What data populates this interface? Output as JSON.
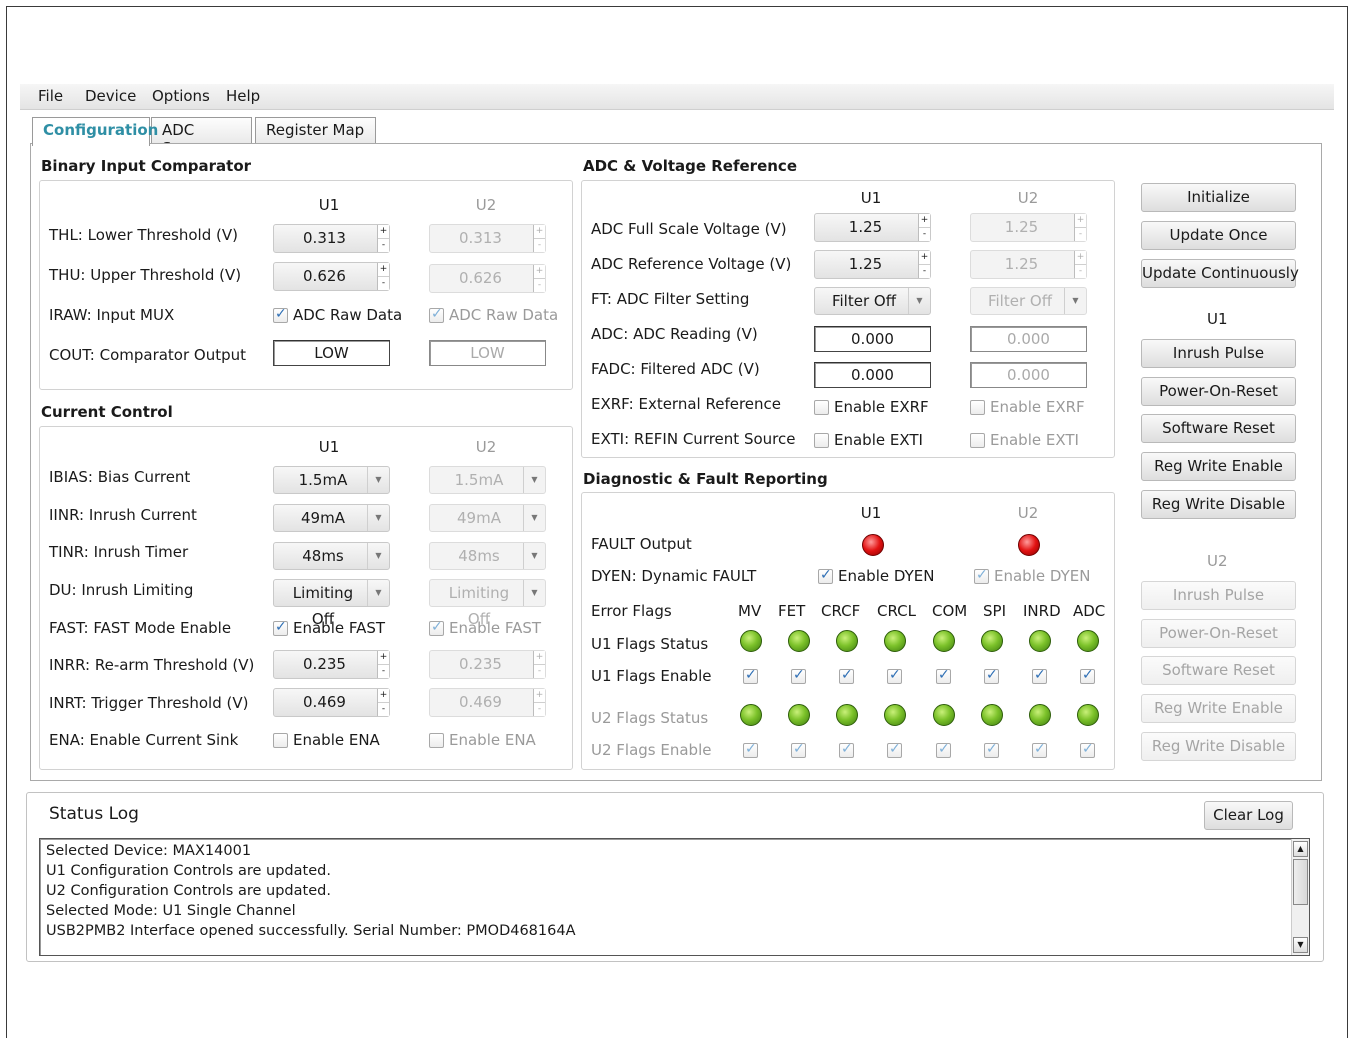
{
  "menu": [
    "File",
    "Device",
    "Options",
    "Help"
  ],
  "tabs": [
    "Configuration",
    "ADC Scope",
    "Register Map"
  ],
  "binary": {
    "title": "Binary Input Comparator",
    "u1": "U1",
    "u2": "U2",
    "thl_label": "THL: Lower Threshold (V)",
    "thl_u1": "0.313",
    "thl_u2": "0.313",
    "thu_label": "THU: Upper Threshold (V)",
    "thu_u1": "0.626",
    "thu_u2": "0.626",
    "iraw_label": "IRAW: Input MUX",
    "iraw_u1": "ADC Raw Data",
    "iraw_u2": "ADC Raw Data",
    "cout_label": "COUT: Comparator Output",
    "cout_u1": "LOW",
    "cout_u2": "LOW"
  },
  "current": {
    "title": "Current Control",
    "u1": "U1",
    "u2": "U2",
    "ibias_label": "IBIAS: Bias Current",
    "ibias_u1": "1.5mA",
    "ibias_u2": "1.5mA",
    "iinr_label": "IINR: Inrush Current",
    "iinr_u1": "49mA",
    "iinr_u2": "49mA",
    "tinr_label": "TINR: Inrush Timer",
    "tinr_u1": "48ms",
    "tinr_u2": "48ms",
    "du_label": "DU: Inrush Limiting",
    "du_u1": "Limiting Off",
    "du_u2": "Limiting Off",
    "fast_label": "FAST: FAST Mode Enable",
    "fast_u1": "Enable FAST",
    "fast_u2": "Enable FAST",
    "inrr_label": "INRR: Re-arm Threshold (V)",
    "inrr_u1": "0.235",
    "inrr_u2": "0.235",
    "inrt_label": "INRT: Trigger Threshold (V)",
    "inrt_u1": "0.469",
    "inrt_u2": "0.469",
    "ena_label": "ENA: Enable Current Sink",
    "ena_u1": "Enable ENA",
    "ena_u2": "Enable ENA"
  },
  "adc": {
    "title": "ADC & Voltage Reference",
    "u1": "U1",
    "u2": "U2",
    "fs_label": "ADC Full Scale Voltage (V)",
    "fs_u1": "1.25",
    "fs_u2": "1.25",
    "ref_label": "ADC Reference Voltage (V)",
    "ref_u1": "1.25",
    "ref_u2": "1.25",
    "ft_label": "FT: ADC Filter Setting",
    "ft_u1": "Filter Off",
    "ft_u2": "Filter Off",
    "reading_label": "ADC: ADC Reading (V)",
    "reading_u1": "0.000",
    "reading_u2": "0.000",
    "fadc_label": "FADC: Filtered ADC (V)",
    "fadc_u1": "0.000",
    "fadc_u2": "0.000",
    "exrf_label": "EXRF: External Reference",
    "exrf_u1": "Enable EXRF",
    "exrf_u2": "Enable EXRF",
    "exti_label": "EXTI: REFIN Current Source",
    "exti_u1": "Enable EXTI",
    "exti_u2": "Enable EXTI"
  },
  "diag": {
    "title": "Diagnostic & Fault Reporting",
    "u1": "U1",
    "u2": "U2",
    "fault_label": "FAULT Output",
    "dyen_label": "DYEN: Dynamic FAULT",
    "dyen_u1": "Enable DYEN",
    "dyen_u2": "Enable DYEN",
    "error_flags_label": "Error Flags",
    "flags": [
      "MV",
      "FET",
      "CRCF",
      "CRCL",
      "COM",
      "SPI",
      "INRD",
      "ADC"
    ],
    "u1_status_label": "U1 Flags Status",
    "u1_enable_label": "U1 Flags Enable",
    "u2_status_label": "U2 Flags Status",
    "u2_enable_label": "U2 Flags Enable"
  },
  "buttons": {
    "initialize": "Initialize",
    "update_once": "Update Once",
    "update_cont": "Update Continuously",
    "u1_head": "U1",
    "u2_head": "U2",
    "inrush": "Inrush Pulse",
    "por": "Power-On-Reset",
    "soft_reset": "Software Reset",
    "reg_en": "Reg Write Enable",
    "reg_dis": "Reg Write Disable"
  },
  "status_log": {
    "title": "Status Log",
    "clear": "Clear Log",
    "lines": [
      "Selected Device: MAX14001",
      "U1 Configuration Controls are updated.",
      "U2 Configuration Controls are updated.",
      "Selected Mode: U1 Single Channel",
      "USB2PMB2 Interface opened successfully. Serial Number: PMOD468164A"
    ]
  },
  "colors": {
    "accent": "#2f8fa5",
    "led_green": "#7cc22a",
    "led_red": "#e21212"
  }
}
